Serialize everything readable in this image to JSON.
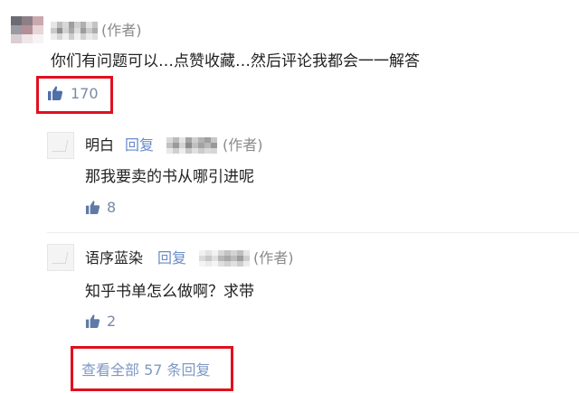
{
  "comment": {
    "author_tag": "(作者)",
    "text": "你们有问题可以…点赞收藏…然后评论我都会一一解答",
    "likes": "170"
  },
  "replies": [
    {
      "name": "明白",
      "reply_label": "回复",
      "target_tag": "(作者)",
      "text": "那我要卖的书从哪引进呢",
      "likes": "8"
    },
    {
      "name": "语序蓝染",
      "reply_label": "回复",
      "target_tag": "(作者)",
      "text": "知乎书单怎么做啊？求带",
      "likes": "2"
    }
  ],
  "view_all": "查看全部 57 条回复",
  "icons": {
    "like": "thumbs-up-icon"
  },
  "colors": {
    "highlight": "#e0101f",
    "link": "#7e98c5",
    "meta": "#8a8a8a"
  }
}
